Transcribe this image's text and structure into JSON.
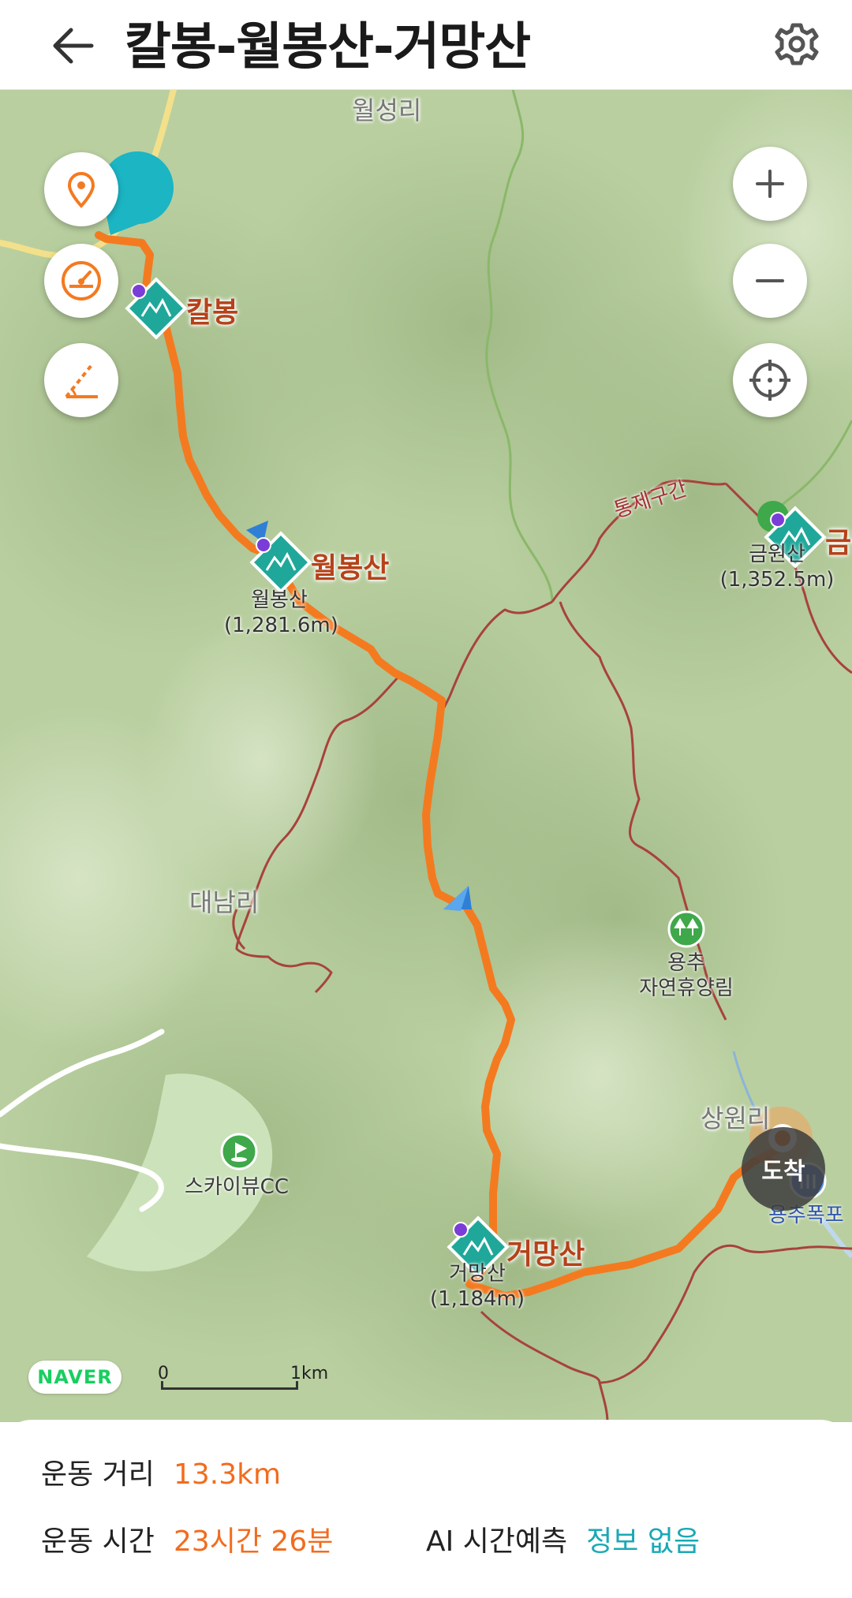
{
  "header": {
    "title": "칼봉-월봉산-거망산",
    "back_icon": "arrow-left-icon",
    "settings_icon": "gear-icon"
  },
  "map": {
    "places": {
      "wolseongri": "월성리",
      "daenamri": "대남리",
      "sangwon": "상원리"
    },
    "trail_label": "통제구간",
    "peaks": {
      "kalbong": {
        "name": "칼봉"
      },
      "wolbong": {
        "name": "월봉산",
        "sub_name": "월봉산",
        "elevation": "(1,281.6m)"
      },
      "geomang": {
        "name": "거망산",
        "sub_name": "거망산",
        "elevation": "(1,184m)"
      },
      "geumwon": {
        "name": "금원산",
        "sub_name": "금원산",
        "elevation": "(1,352.5m)"
      }
    },
    "pois": {
      "forest_line1": "용추",
      "forest_line2": "자연휴양림",
      "golf": "스카이뷰CC",
      "waterfall": "용추폭포"
    },
    "logo": "NAVER",
    "scale": {
      "start": "0",
      "end": "1km"
    },
    "arrive_button": "도착",
    "controls": {
      "left": [
        "location-pin-icon",
        "speedometer-icon",
        "elevation-icon"
      ],
      "right": [
        "zoom-in-icon",
        "zoom-out-icon",
        "crosshair-icon"
      ]
    },
    "colors": {
      "route": "#f47a20",
      "trail": "#a8423c",
      "water": "#7ab35a",
      "peak_marker": "#1fa89a",
      "accent": "#1bb5c4"
    }
  },
  "stats": {
    "distance_label": "운동 거리",
    "distance_value": "13.3km",
    "time_label": "운동 시간",
    "time_value": "23시간 26분",
    "ai_label": "AI 시간예측",
    "ai_value": "정보 없음"
  }
}
